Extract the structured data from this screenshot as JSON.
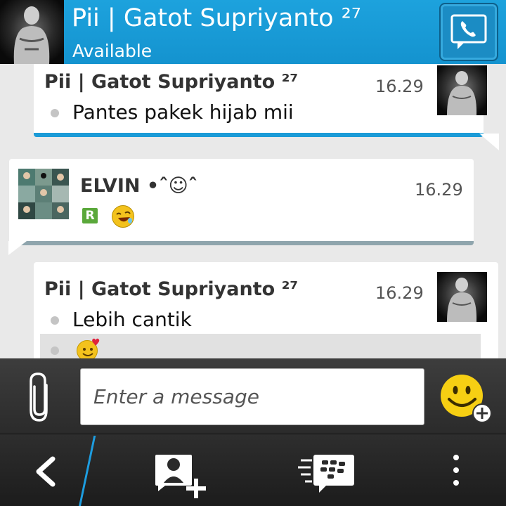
{
  "header": {
    "title": "Pii | Gatot Supriyanto ²⁷",
    "status": "Available"
  },
  "messages": [
    {
      "sender": "Pii | Gatot Supriyanto ²⁷",
      "time": "16.29",
      "text": "Pantes pakek hijab mii"
    },
    {
      "sender": "ELVIN •ˆ☺ˆ",
      "time": "16.29",
      "badge": "R"
    },
    {
      "sender": "Pii | Gatot Supriyanto ²⁷",
      "time": "16.29",
      "text": "Lebih cantik"
    }
  ],
  "compose": {
    "placeholder": "Enter a message"
  },
  "icons": {
    "call": "phone-icon",
    "attach": "paperclip-icon",
    "emoji": "emoticon-add-icon",
    "back": "back-icon",
    "invite": "add-contact-icon",
    "bbm": "bbm-icon",
    "overflow": "more-icon"
  },
  "colors": {
    "header": "#1da2dd",
    "accent": "#1b9bd7"
  }
}
